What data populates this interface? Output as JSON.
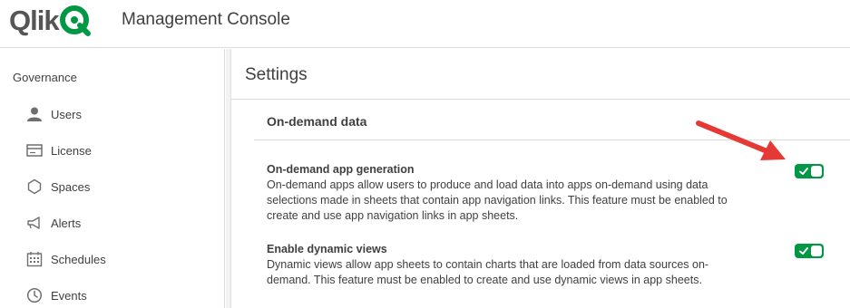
{
  "header": {
    "logo_text": "Qlik",
    "app_title": "Management Console"
  },
  "sidebar": {
    "section": "Governance",
    "items": [
      {
        "label": "Users",
        "icon": "user-icon"
      },
      {
        "label": "License",
        "icon": "license-icon"
      },
      {
        "label": "Spaces",
        "icon": "spaces-icon"
      },
      {
        "label": "Alerts",
        "icon": "alerts-icon"
      },
      {
        "label": "Schedules",
        "icon": "calendar-icon"
      },
      {
        "label": "Events",
        "icon": "clock-icon"
      }
    ]
  },
  "main": {
    "title": "Settings",
    "section_title": "On-demand data",
    "settings": [
      {
        "title": "On-demand app generation",
        "description": "On-demand apps allow users to produce and load data into apps on-demand using data selections made in sheets that contain app navigation links. This feature must be enabled to create and use app navigation links in app sheets.",
        "enabled": true
      },
      {
        "title": "Enable dynamic views",
        "description": "Dynamic views allow app sheets to contain charts that are loaded from data sources on-demand. This feature must be enabled to create and use dynamic views in app sheets.",
        "enabled": true
      }
    ]
  },
  "colors": {
    "accent_green": "#009845",
    "annotation_arrow": "#e53935",
    "text": "#404040"
  }
}
